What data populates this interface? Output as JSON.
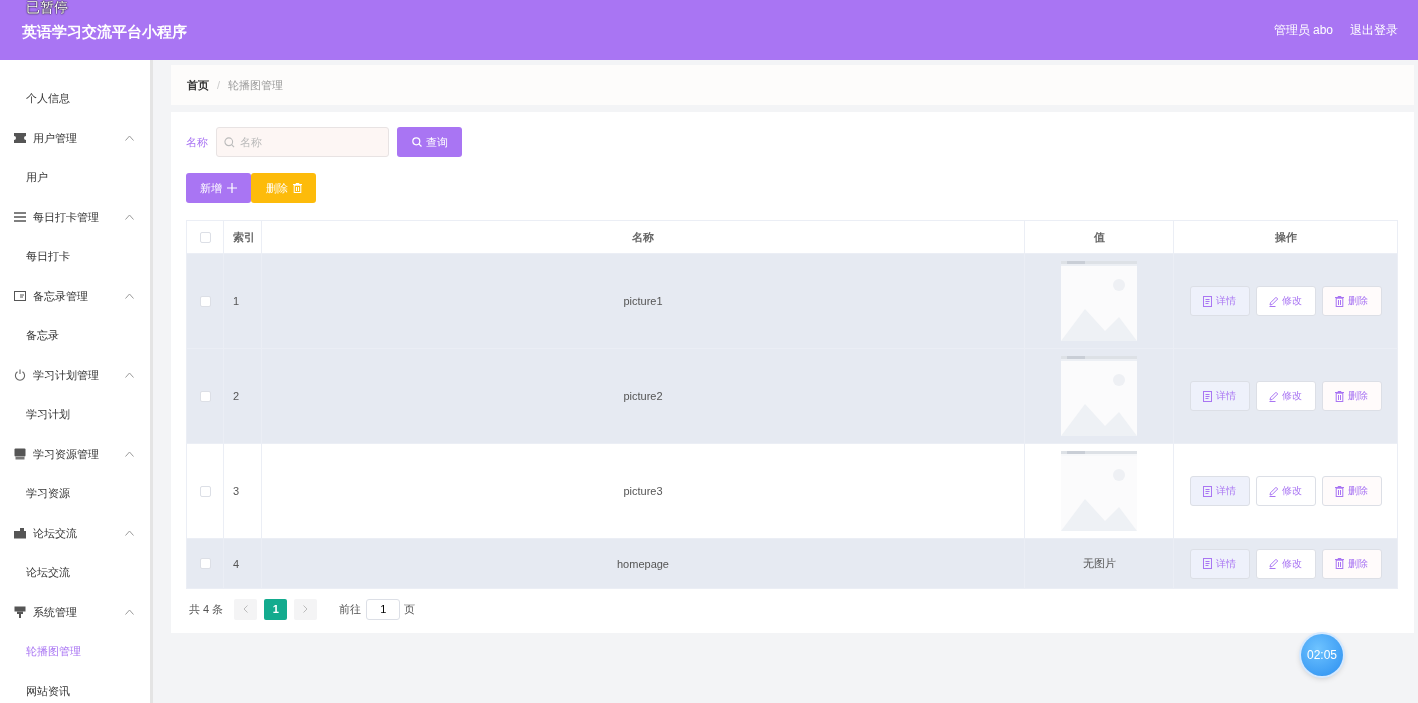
{
  "overlay_label": "已暂停",
  "header": {
    "title": "英语学习交流平台小程序",
    "user": "管理员 abo",
    "logout": "退出登录"
  },
  "sidebar": {
    "items": [
      {
        "label": "个人信息",
        "selected": false
      },
      {
        "label": "用户管理",
        "expanded": true,
        "children": [
          {
            "label": "用户",
            "selected": false
          }
        ]
      },
      {
        "label": "每日打卡管理",
        "expanded": true,
        "children": [
          {
            "label": "每日打卡",
            "selected": false
          }
        ]
      },
      {
        "label": "备忘录管理",
        "expanded": true,
        "children": [
          {
            "label": "备忘录",
            "selected": false
          }
        ]
      },
      {
        "label": "学习计划管理",
        "expanded": true,
        "children": [
          {
            "label": "学习计划",
            "selected": false
          }
        ]
      },
      {
        "label": "学习资源管理",
        "expanded": true,
        "children": [
          {
            "label": "学习资源",
            "selected": false
          }
        ]
      },
      {
        "label": "论坛交流",
        "expanded": true,
        "children": [
          {
            "label": "论坛交流",
            "selected": false
          }
        ]
      },
      {
        "label": "系统管理",
        "expanded": true,
        "children": [
          {
            "label": "轮播图管理",
            "selected": true
          },
          {
            "label": "网站资讯",
            "selected": false
          }
        ]
      }
    ]
  },
  "breadcrumb": {
    "separator": "/",
    "items": [
      "首页",
      "轮播图管理"
    ]
  },
  "search": {
    "label": "名称",
    "placeholder": "名称",
    "button": "查询"
  },
  "actions": {
    "add": "新增",
    "delete": "删除"
  },
  "table": {
    "select_all_checked": false,
    "columns": [
      "索引",
      "名称",
      "值",
      "操作"
    ],
    "rows": [
      {
        "checked": false,
        "highlighted": true,
        "index": "1",
        "name": "picture1",
        "value": {
          "kind": "picture"
        },
        "buttons": [
          "详情",
          "修改",
          "删除"
        ]
      },
      {
        "checked": false,
        "highlighted": true,
        "index": "2",
        "name": "picture2",
        "value": {
          "kind": "picture"
        },
        "buttons": [
          "详情",
          "修改",
          "删除"
        ]
      },
      {
        "checked": false,
        "highlighted": false,
        "index": "3",
        "name": "picture3",
        "value": {
          "kind": "picture"
        },
        "buttons": [
          "详情",
          "修改",
          "删除"
        ]
      },
      {
        "checked": false,
        "highlighted": true,
        "index": "4",
        "name": "homepage",
        "value": {
          "kind": "text",
          "text": "无图片"
        },
        "buttons": [
          "详情",
          "修改",
          "删除"
        ]
      }
    ]
  },
  "pagination": {
    "total": "共 4 条",
    "pages": [
      {
        "label": "1",
        "selected": true
      }
    ],
    "goto_label": "前往",
    "goto_value": "1",
    "page_unit": "页"
  },
  "timer": "02:05"
}
